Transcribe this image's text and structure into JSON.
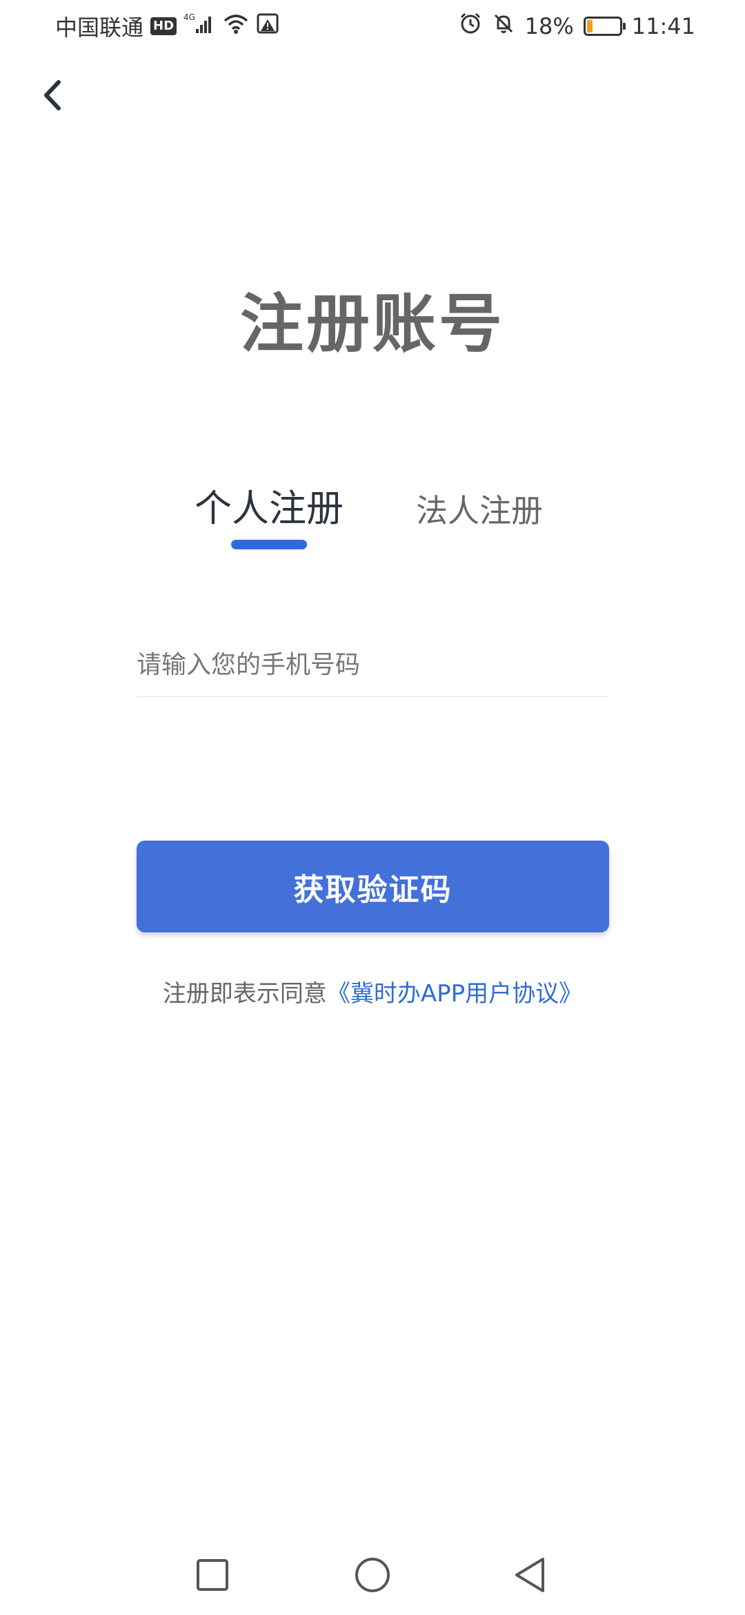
{
  "status_bar": {
    "carrier": "中国联通",
    "hd": "HD",
    "network": "4G",
    "battery": "18%",
    "battery_level": 0.18,
    "time": "11:41"
  },
  "header": {
    "back_icon": "chevron-left-icon"
  },
  "page": {
    "title": "注册账号"
  },
  "tabs": [
    {
      "label": "个人注册",
      "active": true
    },
    {
      "label": "法人注册",
      "active": false
    }
  ],
  "form": {
    "phone_placeholder": "请输入您的手机号码",
    "phone_value": ""
  },
  "button": {
    "label": "获取验证码"
  },
  "agreement": {
    "prefix": "注册即表示同意",
    "link": "《冀时办APP用户协议》"
  },
  "colors": {
    "accent": "#4370d9",
    "link": "#2f6cd8",
    "title": "#666666"
  },
  "nav_bar": {
    "icons": [
      "square-recent-icon",
      "circle-home-icon",
      "triangle-back-icon"
    ]
  }
}
